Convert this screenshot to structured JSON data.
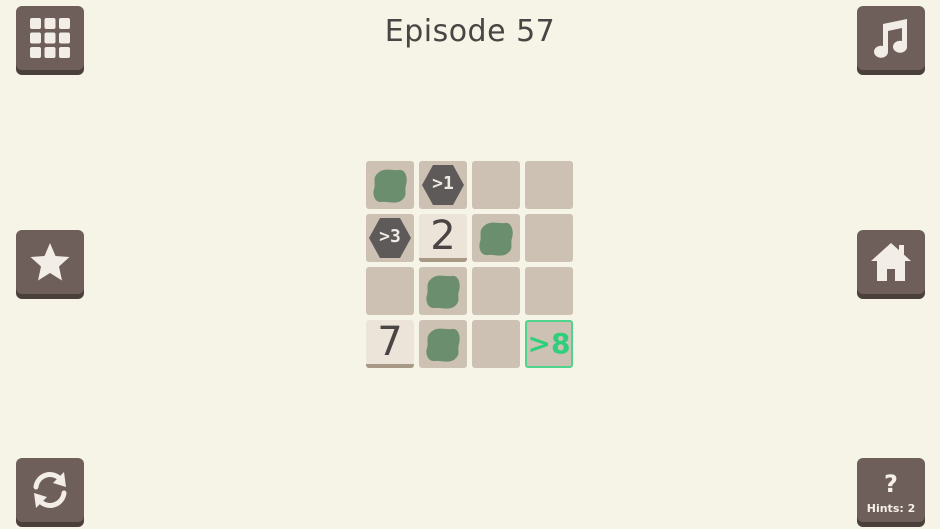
{
  "title": "Episode 57",
  "buttons": {
    "levels_icon": "grid-icon",
    "music_icon": "music-note-icon",
    "star_icon": "star-icon",
    "home_icon": "home-icon",
    "restart_icon": "restart-icon",
    "hint_symbol": "?",
    "hint_label": "Hints: 2"
  },
  "colors": {
    "background": "#f5f4e6",
    "button": "#6f5f5b",
    "cell": "#cdc1b3",
    "blob": "#6b8f6e",
    "hexagon": "#5d5a59",
    "goal": "#2ecf7a"
  },
  "board": {
    "rows": 4,
    "cols": 4,
    "cells": [
      {
        "type": "blob"
      },
      {
        "type": "hex",
        "label": ">1"
      },
      {
        "type": "empty"
      },
      {
        "type": "empty"
      },
      {
        "type": "hex",
        "label": ">3"
      },
      {
        "type": "number",
        "label": "2"
      },
      {
        "type": "blob"
      },
      {
        "type": "empty"
      },
      {
        "type": "empty"
      },
      {
        "type": "blob"
      },
      {
        "type": "empty"
      },
      {
        "type": "empty"
      },
      {
        "type": "number",
        "label": "7"
      },
      {
        "type": "blob"
      },
      {
        "type": "empty"
      },
      {
        "type": "goal",
        "label": ">8"
      }
    ]
  }
}
